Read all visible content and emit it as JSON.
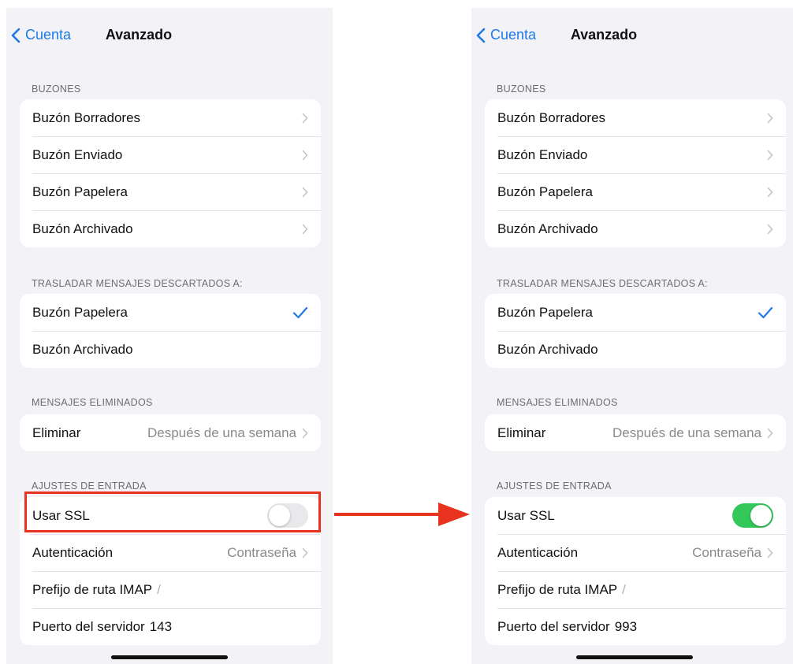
{
  "colors": {
    "accent": "#1e7ae6",
    "toggle_on": "#34c759",
    "toggle_off": "#e9e9eb",
    "highlight": "#e8341f"
  },
  "screens": [
    {
      "nav": {
        "back": "Cuenta",
        "title": "Avanzado"
      },
      "sections": {
        "buzones": {
          "header": "BUZONES",
          "items": [
            "Buzón Borradores",
            "Buzón Enviado",
            "Buzón Papelera",
            "Buzón Archivado"
          ]
        },
        "trasladar": {
          "header": "TRASLADAR MENSAJES DESCARTADOS A:",
          "items": [
            "Buzón Papelera",
            "Buzón Archivado"
          ],
          "selected": "Buzón Papelera"
        },
        "eliminados": {
          "header": "MENSAJES ELIMINADOS",
          "label": "Eliminar",
          "value": "Después de una semana"
        },
        "entrada": {
          "header": "AJUSTES DE ENTRADA",
          "ssl_label": "Usar SSL",
          "ssl_on": false,
          "auth_label": "Autenticación",
          "auth_value": "Contraseña",
          "prefix_label": "Prefijo de ruta IMAP",
          "prefix_value": "/",
          "port_label": "Puerto del servidor",
          "port_value": "143"
        }
      }
    },
    {
      "nav": {
        "back": "Cuenta",
        "title": "Avanzado"
      },
      "sections": {
        "buzones": {
          "header": "BUZONES",
          "items": [
            "Buzón Borradores",
            "Buzón Enviado",
            "Buzón Papelera",
            "Buzón Archivado"
          ]
        },
        "trasladar": {
          "header": "TRASLADAR MENSAJES DESCARTADOS A:",
          "items": [
            "Buzón Papelera",
            "Buzón Archivado"
          ],
          "selected": "Buzón Papelera"
        },
        "eliminados": {
          "header": "MENSAJES ELIMINADOS",
          "label": "Eliminar",
          "value": "Después de una semana"
        },
        "entrada": {
          "header": "AJUSTES DE ENTRADA",
          "ssl_label": "Usar SSL",
          "ssl_on": true,
          "auth_label": "Autenticación",
          "auth_value": "Contraseña",
          "prefix_label": "Prefijo de ruta IMAP",
          "prefix_value": "/",
          "port_label": "Puerto del servidor",
          "port_value": "993"
        }
      }
    }
  ]
}
